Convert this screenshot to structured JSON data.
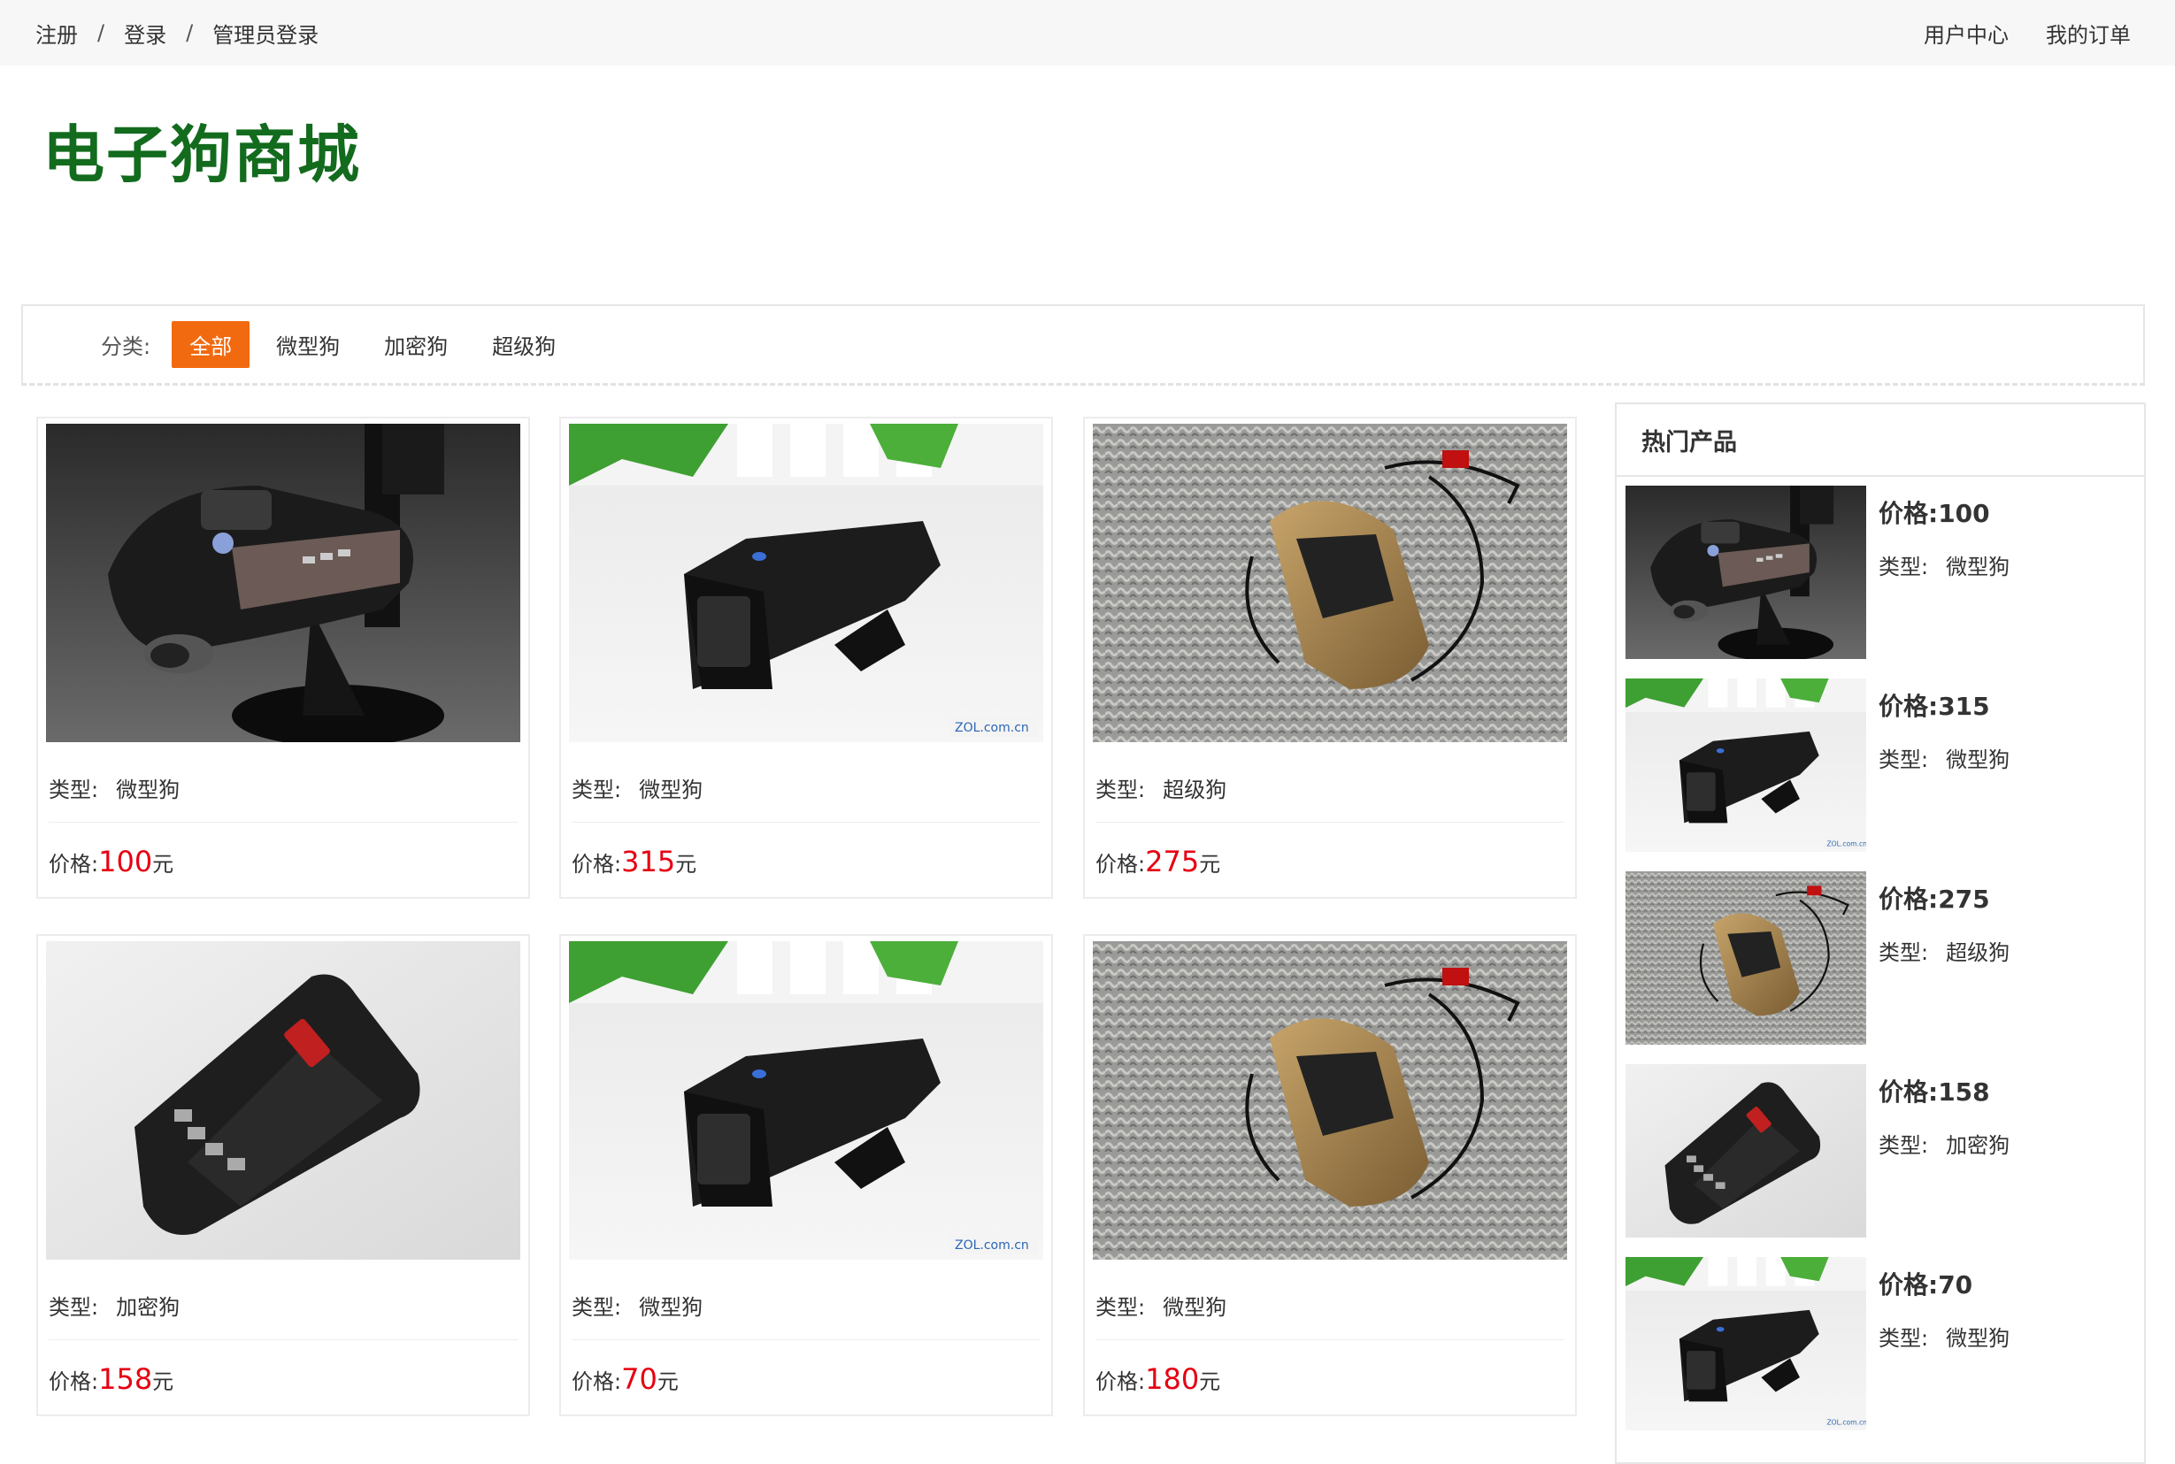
{
  "topbar": {
    "left_links": [
      "注册",
      "登录",
      "管理员登录"
    ],
    "separator": "/",
    "right_links": [
      "用户中心",
      "我的订单"
    ]
  },
  "brand": {
    "title": "电子狗商城",
    "color": "#136b1e"
  },
  "categories": {
    "label": "分类:",
    "items": [
      "全部",
      "微型狗",
      "加密狗",
      "超级狗"
    ],
    "selected": "全部",
    "accent": "#f26a10"
  },
  "product_labels": {
    "type_label": "类型:",
    "price_label": "价格:",
    "unit": "元"
  },
  "products": [
    {
      "image": "dashboard-detector",
      "type": "微型狗",
      "price": "100"
    },
    {
      "image": "black-detector",
      "type": "微型狗",
      "price": "315"
    },
    {
      "image": "car-shaped-detector",
      "type": "超级狗",
      "price": "275"
    },
    {
      "image": "flat-detector",
      "type": "加密狗",
      "price": "158"
    },
    {
      "image": "black-detector",
      "type": "微型狗",
      "price": "70"
    },
    {
      "image": "car-shaped-detector",
      "type": "微型狗",
      "price": "180"
    }
  ],
  "hot": {
    "title": "热门产品",
    "price_label": "价格:",
    "type_label": "类型:",
    "items": [
      {
        "image": "dashboard-detector",
        "price": "100",
        "type": "微型狗"
      },
      {
        "image": "black-detector",
        "price": "315",
        "type": "微型狗"
      },
      {
        "image": "car-shaped-detector",
        "price": "275",
        "type": "超级狗"
      },
      {
        "image": "flat-detector",
        "price": "158",
        "type": "加密狗"
      },
      {
        "image": "black-detector",
        "price": "70",
        "type": "微型狗"
      }
    ]
  },
  "colors": {
    "price": "#e60012",
    "topbar_bg": "#f7f7f7"
  }
}
